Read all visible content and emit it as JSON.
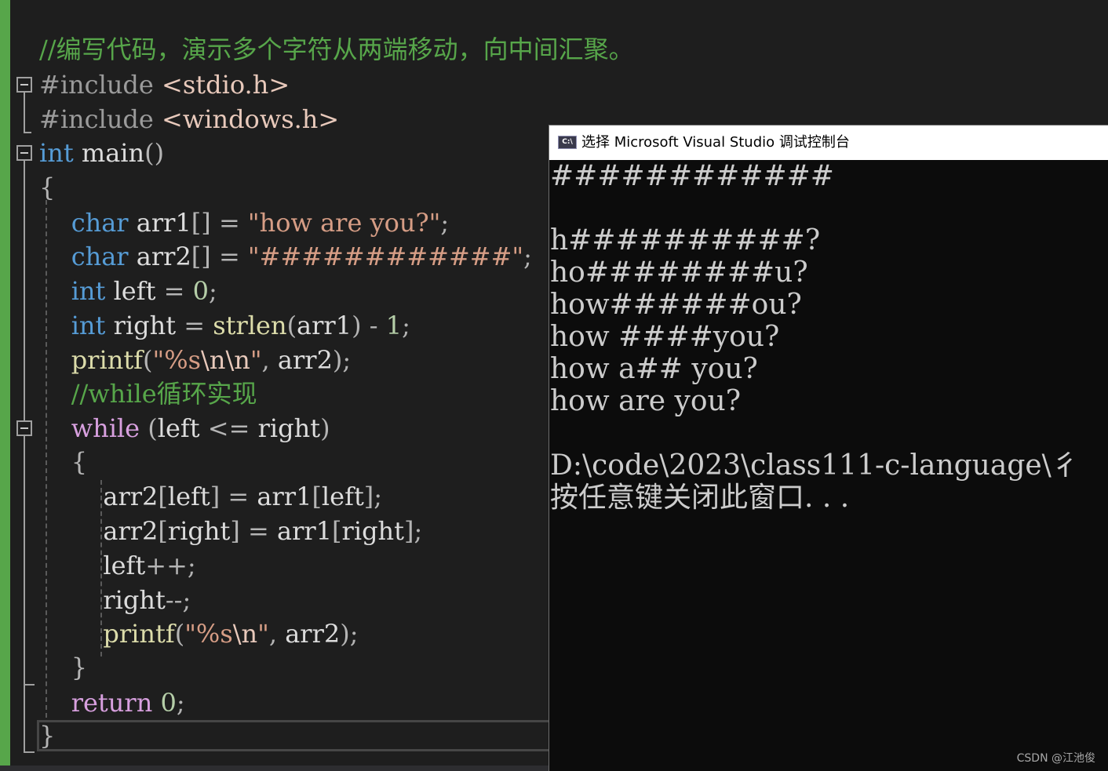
{
  "editor": {
    "lines": [
      {
        "tokens": [
          {
            "t": "//编写代码，演示多个字符从两端移动，向中间汇聚。",
            "c": "cmt"
          }
        ]
      },
      {
        "tokens": [
          {
            "t": "#include ",
            "c": "pp"
          },
          {
            "t": "<stdio.h>",
            "c": "hdr"
          }
        ]
      },
      {
        "tokens": [
          {
            "t": "#include ",
            "c": "pp"
          },
          {
            "t": "<windows.h>",
            "c": "hdr"
          }
        ]
      },
      {
        "tokens": [
          {
            "t": "int",
            "c": "kw"
          },
          {
            "t": " main",
            "c": ""
          },
          {
            "t": "()",
            "c": "op"
          }
        ]
      },
      {
        "tokens": [
          {
            "t": "{",
            "c": "op"
          }
        ]
      },
      {
        "tokens": [
          {
            "t": "    ",
            "c": ""
          },
          {
            "t": "char",
            "c": "kw"
          },
          {
            "t": " arr1",
            "c": ""
          },
          {
            "t": "[]",
            "c": "op"
          },
          {
            "t": " = ",
            "c": "op"
          },
          {
            "t": "\"how are you?\"",
            "c": "str"
          },
          {
            "t": ";",
            "c": "op"
          }
        ]
      },
      {
        "tokens": [
          {
            "t": "    ",
            "c": ""
          },
          {
            "t": "char",
            "c": "kw"
          },
          {
            "t": " arr2",
            "c": ""
          },
          {
            "t": "[]",
            "c": "op"
          },
          {
            "t": " = ",
            "c": "op"
          },
          {
            "t": "\"############\"",
            "c": "str"
          },
          {
            "t": ";",
            "c": "op"
          }
        ]
      },
      {
        "tokens": [
          {
            "t": "    ",
            "c": ""
          },
          {
            "t": "int",
            "c": "kw"
          },
          {
            "t": " left ",
            "c": ""
          },
          {
            "t": "= ",
            "c": "op"
          },
          {
            "t": "0",
            "c": "num"
          },
          {
            "t": ";",
            "c": "op"
          }
        ]
      },
      {
        "tokens": [
          {
            "t": "    ",
            "c": ""
          },
          {
            "t": "int",
            "c": "kw"
          },
          {
            "t": " right ",
            "c": ""
          },
          {
            "t": "= ",
            "c": "op"
          },
          {
            "t": "strlen",
            "c": "fn"
          },
          {
            "t": "(",
            "c": "op"
          },
          {
            "t": "arr1",
            "c": ""
          },
          {
            "t": ") - ",
            "c": "op"
          },
          {
            "t": "1",
            "c": "num"
          },
          {
            "t": ";",
            "c": "op"
          }
        ]
      },
      {
        "tokens": [
          {
            "t": "    ",
            "c": ""
          },
          {
            "t": "printf",
            "c": "fn"
          },
          {
            "t": "(",
            "c": "op"
          },
          {
            "t": "\"%s",
            "c": "str"
          },
          {
            "t": "\\n\\n",
            "c": "esc"
          },
          {
            "t": "\"",
            "c": "str"
          },
          {
            "t": ", ",
            "c": "op"
          },
          {
            "t": "arr2",
            "c": ""
          },
          {
            "t": ");",
            "c": "op"
          }
        ]
      },
      {
        "tokens": [
          {
            "t": "    ",
            "c": ""
          },
          {
            "t": "//while循环实现",
            "c": "cmt"
          }
        ]
      },
      {
        "tokens": [
          {
            "t": "    ",
            "c": ""
          },
          {
            "t": "while",
            "c": "ctl"
          },
          {
            "t": " (",
            "c": "op"
          },
          {
            "t": "left ",
            "c": ""
          },
          {
            "t": "<= ",
            "c": "op"
          },
          {
            "t": "right",
            "c": ""
          },
          {
            "t": ")",
            "c": "op"
          }
        ]
      },
      {
        "tokens": [
          {
            "t": "    ",
            "c": ""
          },
          {
            "t": "{",
            "c": "op"
          }
        ]
      },
      {
        "tokens": [
          {
            "t": "        ",
            "c": ""
          },
          {
            "t": "arr2",
            "c": ""
          },
          {
            "t": "[",
            "c": "op"
          },
          {
            "t": "left",
            "c": ""
          },
          {
            "t": "] = ",
            "c": "op"
          },
          {
            "t": "arr1",
            "c": ""
          },
          {
            "t": "[",
            "c": "op"
          },
          {
            "t": "left",
            "c": ""
          },
          {
            "t": "];",
            "c": "op"
          }
        ]
      },
      {
        "tokens": [
          {
            "t": "        ",
            "c": ""
          },
          {
            "t": "arr2",
            "c": ""
          },
          {
            "t": "[",
            "c": "op"
          },
          {
            "t": "right",
            "c": ""
          },
          {
            "t": "] = ",
            "c": "op"
          },
          {
            "t": "arr1",
            "c": ""
          },
          {
            "t": "[",
            "c": "op"
          },
          {
            "t": "right",
            "c": ""
          },
          {
            "t": "];",
            "c": "op"
          }
        ]
      },
      {
        "tokens": [
          {
            "t": "        ",
            "c": ""
          },
          {
            "t": "left",
            "c": ""
          },
          {
            "t": "++;",
            "c": "op"
          }
        ]
      },
      {
        "tokens": [
          {
            "t": "        ",
            "c": ""
          },
          {
            "t": "right",
            "c": ""
          },
          {
            "t": "--;",
            "c": "op"
          }
        ]
      },
      {
        "tokens": [
          {
            "t": "        ",
            "c": ""
          },
          {
            "t": "printf",
            "c": "fn"
          },
          {
            "t": "(",
            "c": "op"
          },
          {
            "t": "\"%s",
            "c": "str"
          },
          {
            "t": "\\n",
            "c": "esc"
          },
          {
            "t": "\"",
            "c": "str"
          },
          {
            "t": ", ",
            "c": "op"
          },
          {
            "t": "arr2",
            "c": ""
          },
          {
            "t": ");",
            "c": "op"
          }
        ]
      },
      {
        "tokens": [
          {
            "t": "    ",
            "c": ""
          },
          {
            "t": "}",
            "c": "op"
          }
        ]
      },
      {
        "tokens": [
          {
            "t": "    ",
            "c": ""
          },
          {
            "t": "return",
            "c": "ctl"
          },
          {
            "t": " ",
            "c": ""
          },
          {
            "t": "0",
            "c": "num"
          },
          {
            "t": ";",
            "c": "op"
          }
        ]
      },
      {
        "tokens": [
          {
            "t": "}",
            "c": "op"
          }
        ]
      }
    ]
  },
  "console": {
    "icon_text": "C:\\",
    "icon_name": "console-app-icon",
    "title": "选择 Microsoft Visual Studio 调试控制台",
    "output": [
      "############",
      "",
      "h##########?",
      "ho########u?",
      "how######ou?",
      "how ####you?",
      "how a## you?",
      "how are you?",
      "",
      "D:\\code\\2023\\class111-c-language\\彳",
      "按任意键关闭此窗口. . ."
    ]
  },
  "watermark": "CSDN @江池俊",
  "colors": {
    "editor_bg": "#1e1e1e",
    "keyword": "#569cd6",
    "control_keyword": "#d8a0df",
    "string": "#d69d85",
    "comment": "#57a64a",
    "number": "#b5cea8",
    "console_bg": "#0c0c0c",
    "console_text": "#cccccc"
  }
}
